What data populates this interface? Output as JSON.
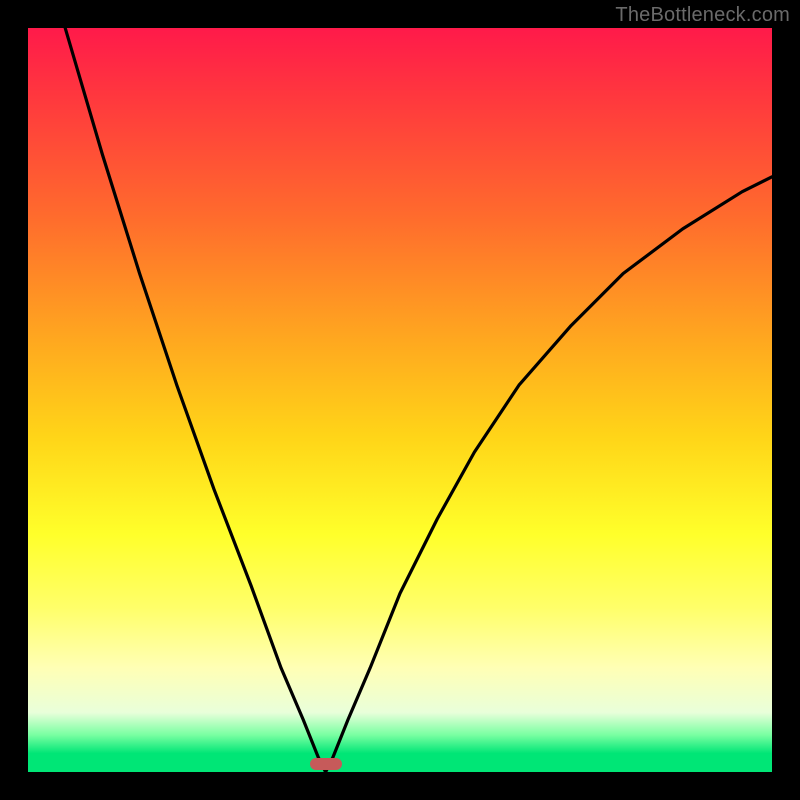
{
  "attribution": "TheBottleneck.com",
  "colors": {
    "frame": "#000000",
    "marker": "#c65a5a",
    "curve": "#000000",
    "gradient_top": "#ff1a4a",
    "gradient_bottom": "#00e676"
  },
  "chart_data": {
    "type": "line",
    "title": "",
    "xlabel": "",
    "ylabel": "",
    "xlim": [
      0,
      100
    ],
    "ylim": [
      0,
      100
    ],
    "grid": false,
    "legend": false,
    "optimum_x": 40,
    "marker": {
      "x": 40,
      "y": 0
    },
    "series": [
      {
        "name": "bottleneck-curve",
        "x": [
          0,
          5,
          10,
          15,
          20,
          25,
          30,
          34,
          37,
          39,
          40,
          41,
          43,
          46,
          50,
          55,
          60,
          66,
          73,
          80,
          88,
          96,
          100
        ],
        "y": [
          118,
          100,
          83,
          67,
          52,
          38,
          25,
          14,
          7,
          2,
          0,
          2,
          7,
          14,
          24,
          34,
          43,
          52,
          60,
          67,
          73,
          78,
          80
        ]
      }
    ],
    "gradient_stops": [
      {
        "pos": 0,
        "color": "#ff1a4a"
      },
      {
        "pos": 0.1,
        "color": "#ff3a3d"
      },
      {
        "pos": 0.25,
        "color": "#ff6a2d"
      },
      {
        "pos": 0.42,
        "color": "#ffa81f"
      },
      {
        "pos": 0.55,
        "color": "#ffd518"
      },
      {
        "pos": 0.68,
        "color": "#ffff2a"
      },
      {
        "pos": 0.78,
        "color": "#ffff6a"
      },
      {
        "pos": 0.86,
        "color": "#ffffb5"
      },
      {
        "pos": 0.92,
        "color": "#e9ffda"
      },
      {
        "pos": 0.95,
        "color": "#7affa2"
      },
      {
        "pos": 0.975,
        "color": "#00e676"
      },
      {
        "pos": 1.0,
        "color": "#00e676"
      }
    ]
  }
}
